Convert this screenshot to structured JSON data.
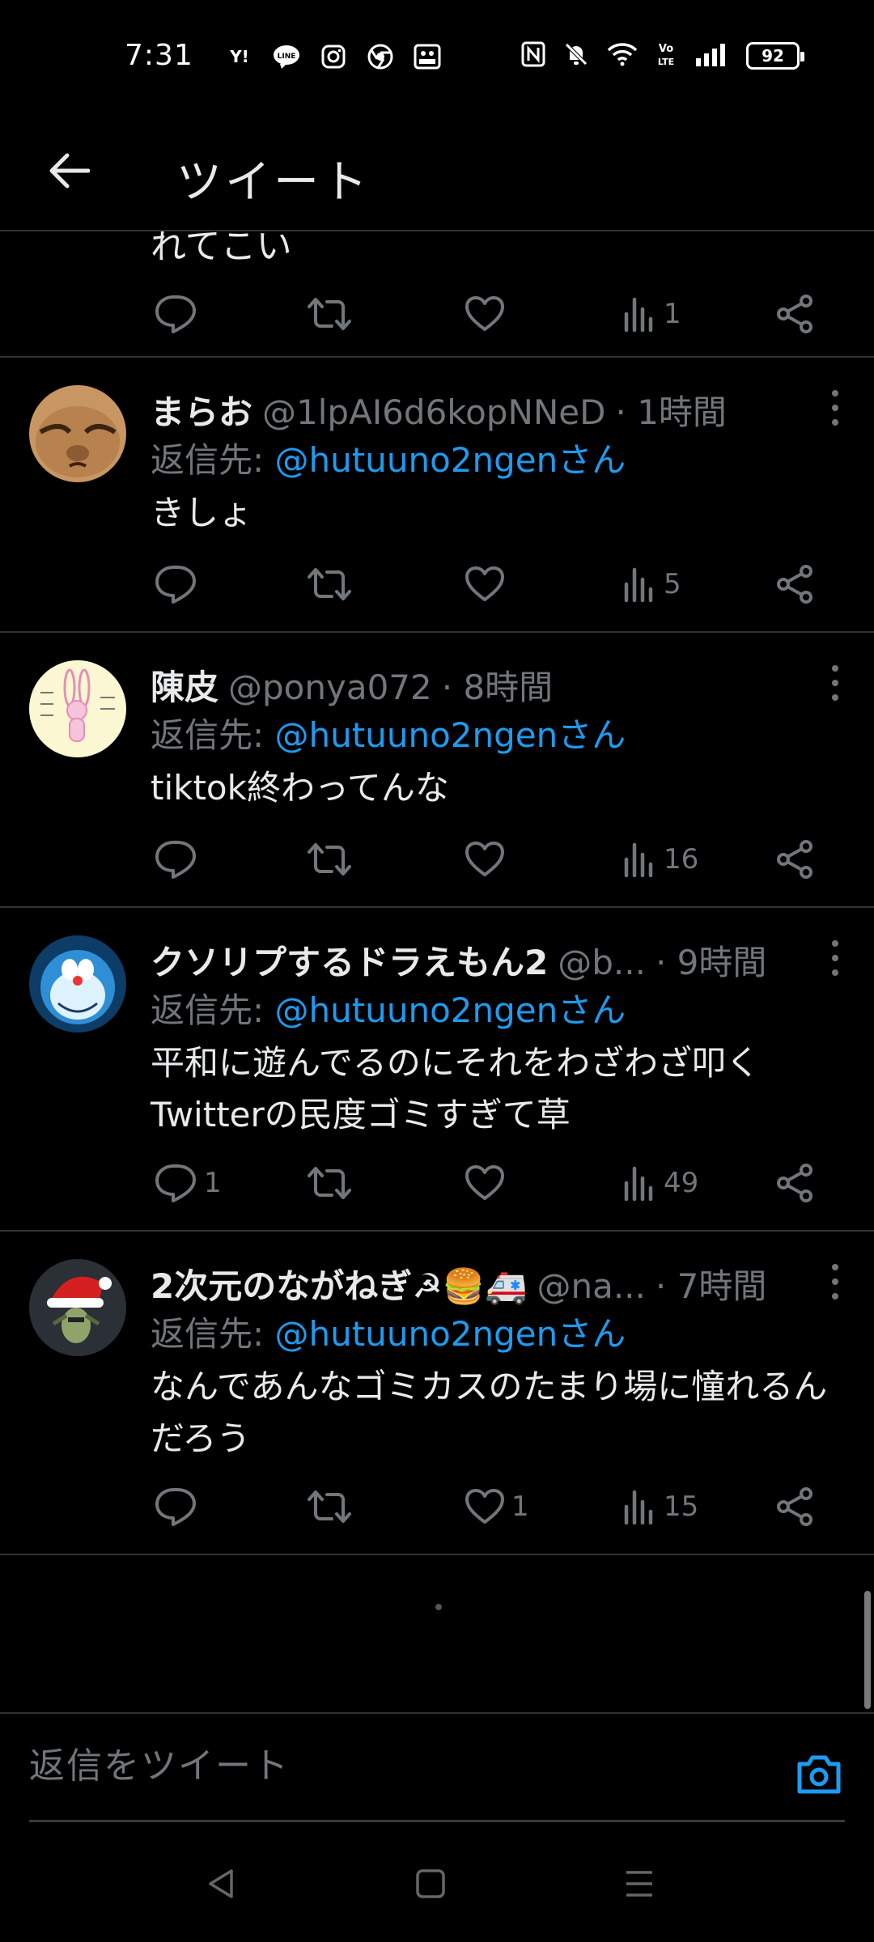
{
  "status_bar": {
    "time": "7:31",
    "apps": [
      "Y!",
      "LINE",
      "instagram-icon",
      "chrome-icon",
      "photo-icon"
    ],
    "battery": "92"
  },
  "header": {
    "title": "ツイート"
  },
  "partial_tweet": {
    "text": "れてこい",
    "views": "1"
  },
  "tweets": [
    {
      "name": "まらお",
      "handle": "@1lpAI6d6kopNNeD",
      "time": "· 1時間",
      "reply_prefix": "返信先: ",
      "reply_mention": "@hutuuno2ngenさん",
      "text": "きしょ",
      "replies": "",
      "likes": "",
      "views": "5"
    },
    {
      "name": "陳皮",
      "handle": "@ponya072",
      "time": "· 8時間",
      "reply_prefix": "返信先: ",
      "reply_mention": "@hutuuno2ngenさん",
      "text": "tiktok終わってんな",
      "replies": "",
      "likes": "",
      "views": "16"
    },
    {
      "name": "クソリプするドラえもん2",
      "handle": "@b...",
      "time": "· 9時間",
      "reply_prefix": "返信先: ",
      "reply_mention": "@hutuuno2ngenさん",
      "text": "平和に遊んでるのにそれをわざわざ叩くTwitterの民度ゴミすぎて草",
      "replies": "1",
      "likes": "",
      "views": "49"
    },
    {
      "name": "2次元のながねぎ☭🍔🚑",
      "handle": "@na...",
      "time": "· 7時間",
      "reply_prefix": "返信先: ",
      "reply_mention": "@hutuuno2ngenさん",
      "text": "なんであんなゴミカスのたまり場に憧れるんだろう",
      "replies": "",
      "likes": "1",
      "views": "15"
    }
  ],
  "reply_bar": {
    "placeholder": "返信をツイート"
  },
  "colors": {
    "accent": "#1d9bf0",
    "muted": "#71767b",
    "text": "#e7e9ea"
  }
}
